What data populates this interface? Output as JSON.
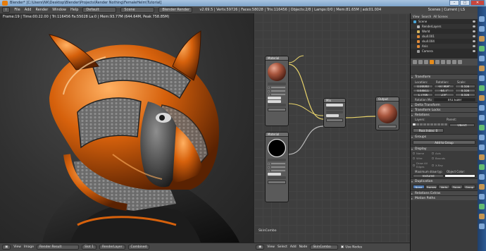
{
  "window": {
    "title": "Blender* [C:\\Users\\NK\\Desktop\\Blender\\Projects\\Render Nothing\\FemaleHelm\\Tutorial]",
    "controls": [
      "–",
      "□",
      "✕"
    ]
  },
  "infobar": {
    "menus": [
      "File",
      "Add",
      "Render",
      "Window",
      "Help"
    ],
    "layout": "Default",
    "scene": "Scene",
    "engine": "Blender Render",
    "stats": "v2.69.5 | Verts:59726 | Faces:58028 | Tris:116456 | Objects:2/8 | Lamps:0/0 | Mem:81.65M | adc01.004",
    "scenes": "Scenes | Current | LS"
  },
  "viewport": {
    "render_info": "Frame:19 | Time:00:22.00 | Tri:116456 Fa:55028 La:0 | Mem:93.77M (644.64M, Peak 758.85M)"
  },
  "nodes": {
    "material_top_label": "Material",
    "material_bottom_label": "Material",
    "mix_label": "Mix",
    "output_label": "Output",
    "tooltip": {
      "line1": "Type of a from data to display and edit",
      "line2": "Python: SpaceNodeEditor.texture",
      "line3": "bpy.data.screens['Default']... Composit"
    },
    "footer_label": "SkinCombo"
  },
  "outliner": {
    "header": [
      "View",
      "Search",
      "All Scenes"
    ],
    "rows": [
      {
        "name": "Scene",
        "color": "#4aa6d8"
      },
      {
        "name": "RenderLayers",
        "color": "#b7b7b7"
      },
      {
        "name": "World",
        "color": "#d6b45d"
      },
      {
        "name": "skull.001",
        "color": "#e08b3a"
      },
      {
        "name": "skull.004",
        "color": "#e08b3a"
      },
      {
        "name": "Anis",
        "color": "#e08b3a"
      },
      {
        "name": "Camera",
        "color": "#9a9a9a"
      }
    ]
  },
  "properties": {
    "transform_title": "Transform",
    "location_label": "Location:",
    "rotation_label": "Rotation:",
    "scale_label": "Scale:",
    "location": [
      "0.00000",
      "0.64811",
      "1.7706"
    ],
    "rotation": [
      "-97.969°",
      "-64.7°",
      "2.9°"
    ],
    "scale": [
      "0.556",
      "0.556",
      "0.556"
    ],
    "rotation_mode_label": "Rotation Mo",
    "rotation_mode": "XYZ Euler",
    "delta_transform": "Delta Transform",
    "transform_locks": "Transform Locks",
    "relations": "Relations",
    "layers_label": "Layers:",
    "parent_label": "Parent:",
    "parent_value": "Object",
    "pass_index": "Pass Index: 0",
    "groups": "Groups",
    "add_to_group": "Add to Group",
    "display": "Display",
    "display_rows": [
      [
        "Name",
        "Axis"
      ],
      [
        "Wire",
        "Bounds"
      ],
      [
        "Draw All Edges",
        "X-Ray"
      ]
    ],
    "max_draw_label": "Maximum draw typ",
    "object_color_label": "Object Color:",
    "max_draw_value": "Textured",
    "duplication": "Duplication",
    "dup_tabs": [
      "None",
      "Frames",
      "Verts",
      "Faces",
      "Group"
    ],
    "relations_extras": "Relations Extras",
    "motion_paths": "Motion Paths"
  },
  "footer": {
    "left": {
      "items": [
        "View",
        "Image"
      ],
      "image_name": "Render Result",
      "slot": "Slot 1",
      "layer": "RenderLayer",
      "pass": "Combined"
    },
    "mid": {
      "items": [
        "View",
        "Select",
        "Add",
        "Node"
      ],
      "node_tree": "SkinCombo",
      "use_nodes": "Use Nodes"
    }
  }
}
